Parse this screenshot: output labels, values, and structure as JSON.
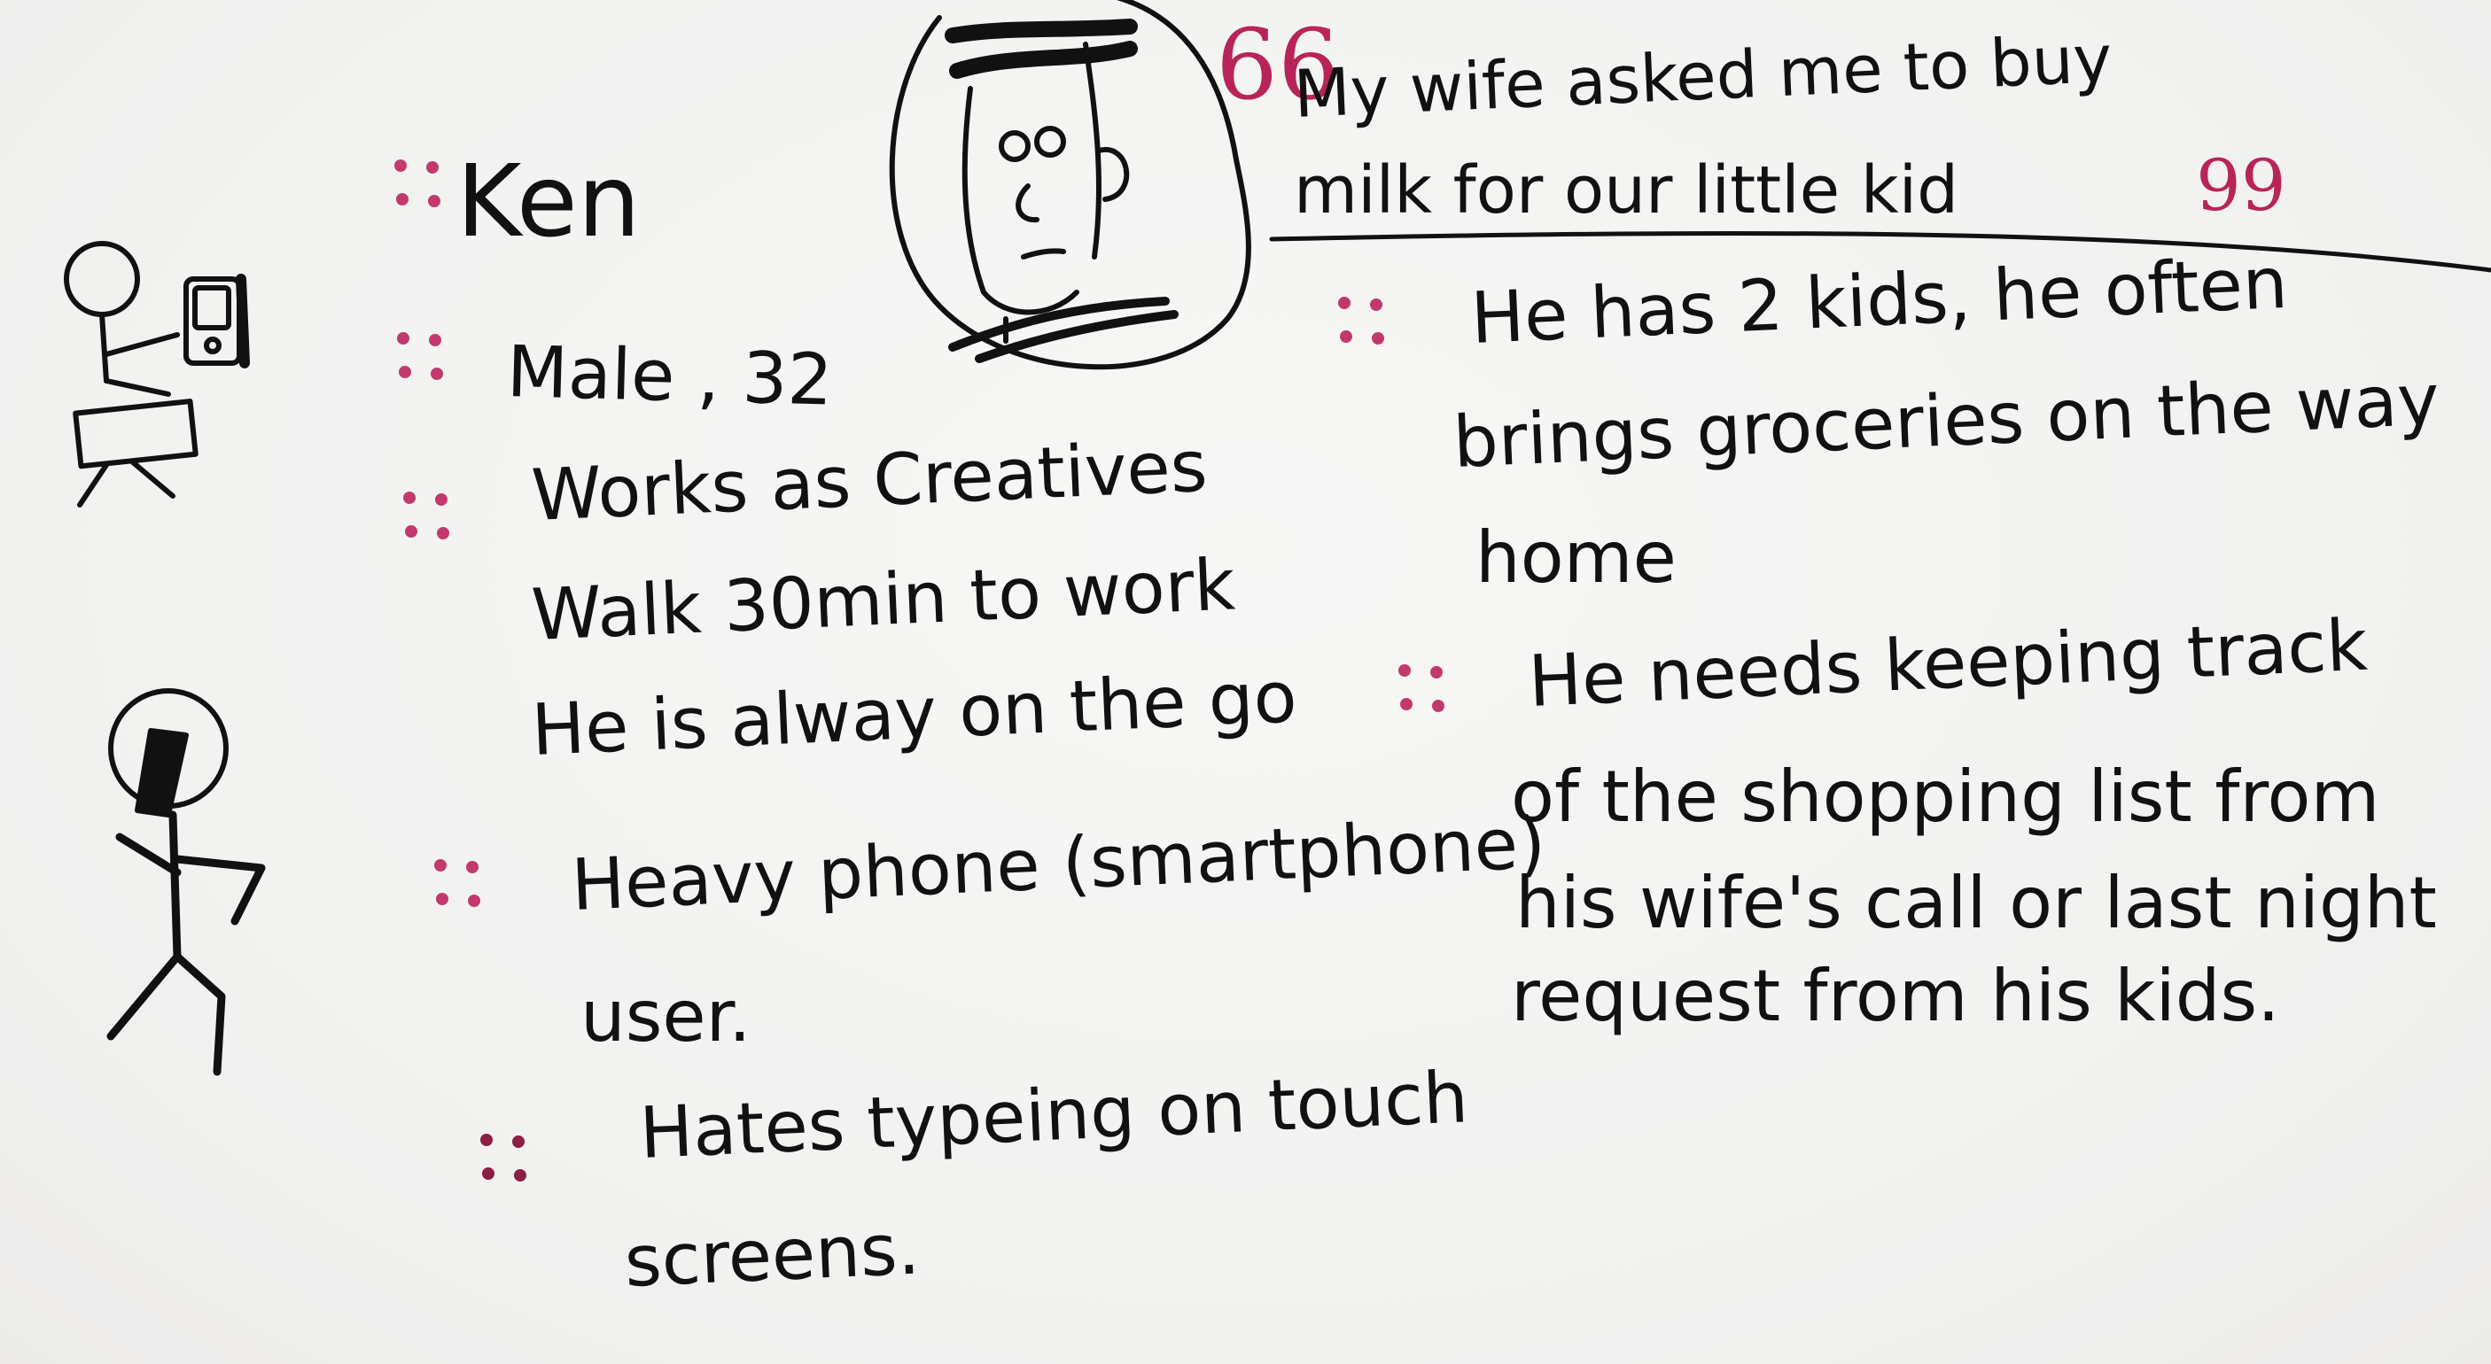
{
  "persona": {
    "name": "Ken"
  },
  "facts": {
    "gender_age": "Male , 32",
    "job": "Works as Creatives",
    "commute": "Walk 30min to work",
    "mobility": "He is alway on the go",
    "phone_1": "Heavy phone (smartphone)",
    "phone_2": "user.",
    "typing_1": "Hates typeing on touch",
    "typing_2": "screens."
  },
  "quote": {
    "line_1": "My wife asked me to buy",
    "line_2": "milk for our little kid",
    "open_mark": "66",
    "close_mark": "99"
  },
  "context": {
    "kids_1": "He has 2 kids, he often",
    "kids_2": "brings groceries on the way",
    "kids_3": "home",
    "needs_1": "He needs keeping track",
    "needs_2": "of the shopping list from",
    "needs_3": "his wife's call or last night",
    "needs_4": "request from his kids."
  },
  "colors": {
    "ink": "#111111",
    "bullet": "#c23a6d",
    "board": "#f4f4f3"
  },
  "icons": [
    "stick-figure-with-device-icon",
    "stick-figure-walking-icon",
    "face-portrait-icon",
    "quote-open-icon",
    "quote-close-icon"
  ]
}
